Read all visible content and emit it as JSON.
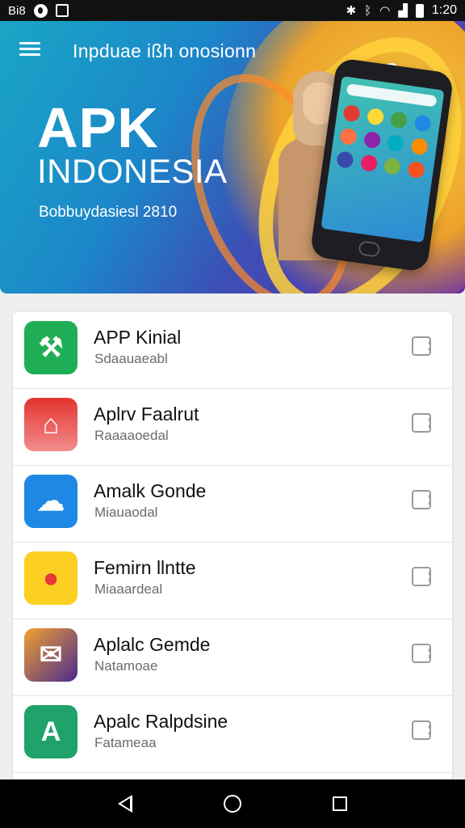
{
  "status_bar": {
    "left_text": "Bi8",
    "time": "1:20"
  },
  "header": {
    "title": "Inpduae ißh onosionn",
    "hero_title_line1": "APK",
    "hero_title_line2": "INDONESIA",
    "hero_subtitle": "Bobbuydasiesl 2810"
  },
  "apps": [
    {
      "name": "APP Kinial",
      "subtitle": "Sdaauaeabl",
      "icon_color": "#1fae55",
      "icon_glyph": "⚒"
    },
    {
      "name": "Aplrv Faalrut",
      "subtitle": "Raaaaoedal",
      "icon_color": "#e3342f",
      "icon_glyph": "⌂"
    },
    {
      "name": "Amalk Gonde",
      "subtitle": "Miauaodal",
      "icon_color": "#1e88e5",
      "icon_glyph": "☁"
    },
    {
      "name": "Femirn llntte",
      "subtitle": "Miaaardeal",
      "icon_color": "#fbd023",
      "icon_glyph": "●"
    },
    {
      "name": "Aplalc Gemde",
      "subtitle": "Natamoae",
      "icon_color": "#4b2a8f",
      "icon_glyph": "✉"
    },
    {
      "name": "Apalc Ralpdsine",
      "subtitle": "Fatameaa",
      "icon_color": "#1fa36a",
      "icon_glyph": "A"
    }
  ],
  "colors": {
    "hero_start": "#1aa6c6",
    "hero_end": "#6b2fa7",
    "accent_yellow": "#ffd33d"
  }
}
